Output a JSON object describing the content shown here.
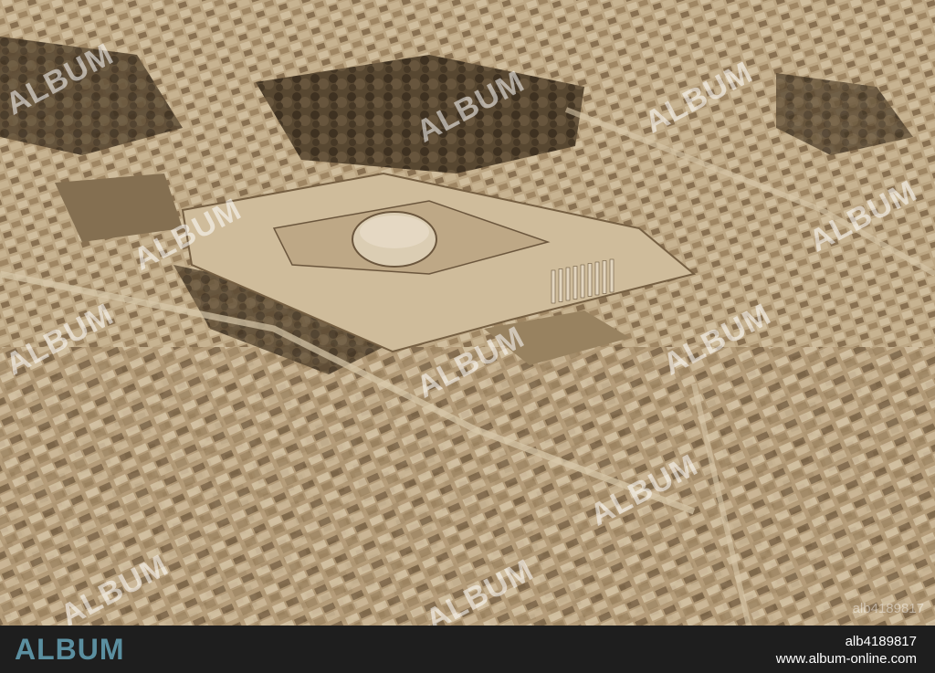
{
  "image": {
    "description_name": "aerial-photo"
  },
  "watermark": {
    "text": "ALBUM",
    "corner_id": "alb4189817"
  },
  "footer": {
    "logo": "ALBUM",
    "image_id": "alb4189817",
    "url": "www.album-online.com"
  },
  "colors": {
    "sepia_light": "#d8c6a6",
    "sepia_mid": "#b9a27e",
    "sepia_dark": "#6f5b40",
    "foliage": "#4e3f2a",
    "footer_bg": "#1e1e1e",
    "logo": "#5b8fa0"
  }
}
